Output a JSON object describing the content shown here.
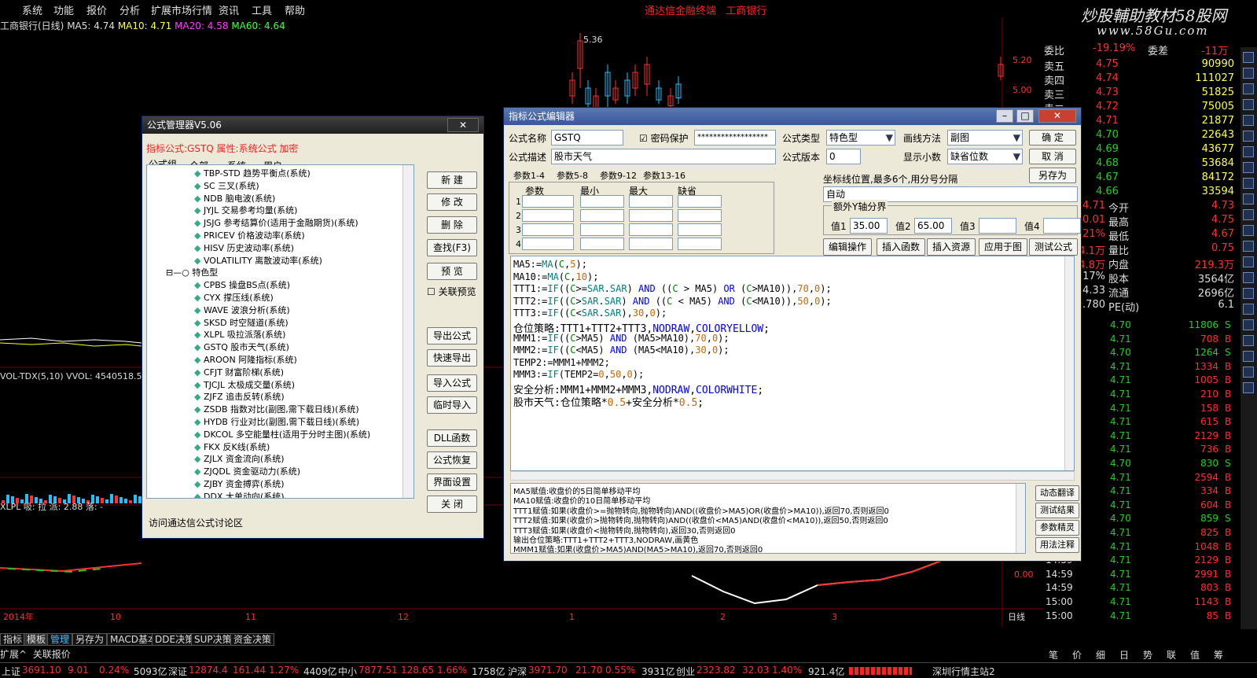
{
  "menu": [
    "系统",
    "功能",
    "报价",
    "分析",
    "扩展市场行情",
    "资讯",
    "工具",
    "帮助"
  ],
  "app_title": "通达信金融终端",
  "app_stock": "工商银行",
  "watermark": "炒股輔助教材58股网",
  "watermark_url": "www.58Gu.com",
  "indicators": {
    "name": "工商银行(日线)",
    "ma5": "MA5: 4.74",
    "ma10": "MA10: 4.71",
    "ma20": "MA20: 4.58",
    "ma60": "MA60: 4.64"
  },
  "price_labels": [
    "5.20",
    "5.00",
    "0.00"
  ],
  "high_mark": "5.36",
  "vol_label": "VOL-TDX(5,10) VVOL: 4540518.5",
  "xlpl_label": "XLPL 吸: 拉 派: 2.88 落: -",
  "year_label": "2014年",
  "x_months": [
    "10",
    "11",
    "12",
    "1",
    "2",
    "3"
  ],
  "period": "日线",
  "bottom_tabs": [
    "指标",
    "模板",
    "管理",
    "另存为",
    "MACD基本",
    "DDE决策",
    "SUP决策",
    "资金决策"
  ],
  "bottom_tabs2": [
    "扩展^",
    "关联报价"
  ],
  "status": {
    "sh_name": "上证",
    "sh_val": "3691.10",
    "sh_chg": "9.01",
    "sh_pct": "0.24%",
    "sh_amt": "5093亿",
    "sz_name": "深证",
    "sz_val": "12874.4",
    "sz_chg": "161.44",
    "sz_pct": "1.27%",
    "sz_amt": "4409亿",
    "zx_name": "中小",
    "zx_val": "7877.51",
    "zx_chg": "128.65",
    "zx_pct": "1.66%",
    "zx_amt": "1758亿",
    "hs_name": "沪深",
    "hs_val": "3971.70",
    "hs_chg": "21.70",
    "hs_pct": "0.55%",
    "hs_amt": "3931亿",
    "cy_name": "创业",
    "cy_val": "2323.82",
    "cy_chg": "32.03",
    "cy_pct": "1.40%",
    "cy_amt": "921.4亿",
    "server": "深圳行情主站2"
  },
  "quote": {
    "weibi_label": "委比",
    "weibi_val": "-19.19%",
    "weicha_label": "委差",
    "weicha_val": "-11万",
    "asks": [
      {
        "l": "卖五",
        "p": "4.75",
        "v": "90990"
      },
      {
        "l": "卖四",
        "p": "4.74",
        "v": "111027"
      },
      {
        "l": "卖三",
        "p": "4.73",
        "v": "51825"
      },
      {
        "l": "卖二",
        "p": "4.72",
        "v": "75005"
      },
      {
        "l": "卖一",
        "p": "4.71",
        "v": "21877"
      }
    ],
    "bids": [
      {
        "l": "买一",
        "p": "4.70",
        "v": "22643"
      },
      {
        "l": "买二",
        "p": "4.69",
        "v": "43677"
      },
      {
        "l": "买三",
        "p": "4.68",
        "v": "53684"
      },
      {
        "l": "买四",
        "p": "4.67",
        "v": "84172"
      },
      {
        "l": "买五",
        "p": "4.66",
        "v": "33594"
      }
    ],
    "stats": [
      {
        "a": "4.71",
        "al": "今开",
        "av": "4.73"
      },
      {
        "a": "-0.01",
        "al": "最高",
        "av": "4.75"
      },
      {
        "a": "-0.21%",
        "al": "最低",
        "av": "4.67"
      },
      {
        "a": "454.1万",
        "al": "量比",
        "av": "0.75"
      },
      {
        "a": "234.8万",
        "al": "内盘",
        "av": "219.3万"
      },
      {
        "a": "0.17%",
        "al": "股本",
        "av": "3564亿"
      },
      {
        "a": "4.33",
        "al": "流通",
        "av": "2696亿"
      },
      {
        "a": "0.780",
        "al": "PE(动)",
        "av": "6.1"
      }
    ],
    "ticks": [
      {
        "t": "",
        "p": "4.70",
        "v": "11806",
        "s": "S"
      },
      {
        "t": "",
        "p": "4.71",
        "v": "708",
        "s": "B"
      },
      {
        "t": "",
        "p": "4.70",
        "v": "1264",
        "s": "S"
      },
      {
        "t": "",
        "p": "4.71",
        "v": "1334",
        "s": "B"
      },
      {
        "t": "",
        "p": "4.71",
        "v": "1005",
        "s": "B"
      },
      {
        "t": "",
        "p": "4.71",
        "v": "210",
        "s": "B"
      },
      {
        "t": "",
        "p": "4.71",
        "v": "158",
        "s": "B"
      },
      {
        "t": "",
        "p": "4.71",
        "v": "615",
        "s": "B"
      },
      {
        "t": "",
        "p": "4.71",
        "v": "2129",
        "s": "B"
      },
      {
        "t": "",
        "p": "4.71",
        "v": "736",
        "s": "B"
      },
      {
        "t": "",
        "p": "4.70",
        "v": "830",
        "s": "S"
      },
      {
        "t": "",
        "p": "4.71",
        "v": "2594",
        "s": "B"
      },
      {
        "t": "",
        "p": "4.71",
        "v": "334",
        "s": "B"
      },
      {
        "t": "",
        "p": "4.71",
        "v": "604",
        "s": "B"
      },
      {
        "t": "",
        "p": "4.70",
        "v": "859",
        "s": "S"
      },
      {
        "t": "",
        "p": "4.71",
        "v": "825",
        "s": "B"
      },
      {
        "t": "",
        "p": "4.71",
        "v": "1048",
        "s": "B"
      },
      {
        "t": "14:59",
        "p": "4.71",
        "v": "2129",
        "s": "B"
      },
      {
        "t": "14:59",
        "p": "4.71",
        "v": "2991",
        "s": "B"
      },
      {
        "t": "14:59",
        "p": "4.71",
        "v": "803",
        "s": "B"
      },
      {
        "t": "15:00",
        "p": "4.71",
        "v": "1143",
        "s": "B"
      },
      {
        "t": "15:00",
        "p": "4.71",
        "v": "85",
        "s": "B"
      }
    ],
    "bottom_tabs": [
      "笔",
      "价",
      "细",
      "日",
      "势",
      "联",
      "值",
      "筹"
    ]
  },
  "fm": {
    "title": "公式管理器V5.06",
    "info": "指标公式:GSTQ 属性:系统公式 加密",
    "tabs": [
      "公式组",
      "全部",
      "系统",
      "用户"
    ],
    "items": [
      "TBP-STD 趋势平衡点(系统)",
      "SC 三叉(系统)",
      "NDB 脑电波(系统)",
      "JYJL 交易参考均量(系统)",
      "JSJG 参考结算价(适用于金融期货)(系统)",
      "PRICEV 价格波动率(系统)",
      "HISV 历史波动率(系统)",
      "VOLATILITY 离散波动率(系统)"
    ],
    "group": "特色型",
    "items2": [
      "CPBS 操盘BS点(系统)",
      "CYX 撑压线(系统)",
      "WAVE 波浪分析(系统)",
      "SKSD 时空隧道(系统)",
      "XLPL 吸拉派落(系统)",
      "GSTQ 股市天气(系统)",
      "AROON 阿隆指标(系统)",
      "CFJT 财富阶梯(系统)",
      "TJCJL 太极成交量(系统)",
      "ZJFZ 追击反转(系统)",
      "ZSDB 指数对比(副图,需下载日线)(系统)",
      "HYDB 行业对比(副图,需下载日线)(系统)",
      "DKCOL 多空能量柱(适用于分时主图)(系统)",
      "FKX 反K线(系统)",
      "ZJLX 资金流向(系统)",
      "ZJQDL 资金驱动力(系统)",
      "ZJBY 资金搏弈(系统)",
      "DDX 大单动向(系统)"
    ],
    "buttons": [
      "新 建",
      "修 改",
      "删 除",
      "查找(F3)",
      "预 览",
      "导出公式",
      "快速导出",
      "导入公式",
      "临时导入",
      "DLL函数",
      "公式恢复",
      "界面设置",
      "关 闭"
    ],
    "link_preview": "关联预览",
    "footer": "访问通达信公式讨论区"
  },
  "fe": {
    "title": "指标公式编辑器",
    "name_label": "公式名称",
    "name_val": "GSTQ",
    "pwd_label": "密码保护",
    "pwd_val": "******************",
    "type_label": "公式类型",
    "type_val": "特色型",
    "draw_label": "画线方法",
    "draw_val": "副图",
    "desc_label": "公式描述",
    "desc_val": "股市天气",
    "ver_label": "公式版本",
    "ver_val": "0",
    "dec_label": "显示小数",
    "dec_val": "缺省位数",
    "ok": "确 定",
    "cancel": "取 消",
    "saveas": "另存为",
    "param_tabs": [
      "参数1-4",
      "参数5-8",
      "参数9-12",
      "参数13-16"
    ],
    "param_headers": [
      "参数",
      "最小",
      "最大",
      "缺省"
    ],
    "param_rows": [
      "1",
      "2",
      "3",
      "4"
    ],
    "coord_label": "坐标线位置,最多6个,用分号分隔",
    "coord_val": "自动",
    "yaxis_label": "额外Y轴分界",
    "vals": [
      {
        "l": "值1",
        "v": "35.00"
      },
      {
        "l": "值2",
        "v": "65.00"
      },
      {
        "l": "值3",
        "v": ""
      },
      {
        "l": "值4",
        "v": ""
      }
    ],
    "action_buttons": [
      "编辑操作",
      "插入函数",
      "插入资源",
      "应用于图",
      "测试公式"
    ],
    "side_buttons": [
      "动态翻译",
      "测试结果",
      "参数精灵",
      "用法注释"
    ],
    "help": [
      "MA5赋值:收盘价的5日简单移动平均",
      "MA10赋值:收盘价的10日简单移动平均",
      "TTT1赋值:如果(收盘价>=抛物转向,抛物转向)AND((收盘价>MA5)OR(收盘价>MA10)),返回70,否则返回0",
      "TTT2赋值:如果(收盘价>抛物转向,抛物转向)AND((收盘价<MA5)AND(收盘价<MA10)),返回50,否则返回0",
      "TTT3赋值:如果(收盘价<抛物转向,抛物转向),返回30,否则返回0",
      "输出仓位策略:TTT1+TTT2+TTT3,NODRAW,画黄色",
      "MMM1赋值:如果(收盘价>MA5)AND(MA5>MA10),返回70,否则返回0"
    ]
  }
}
